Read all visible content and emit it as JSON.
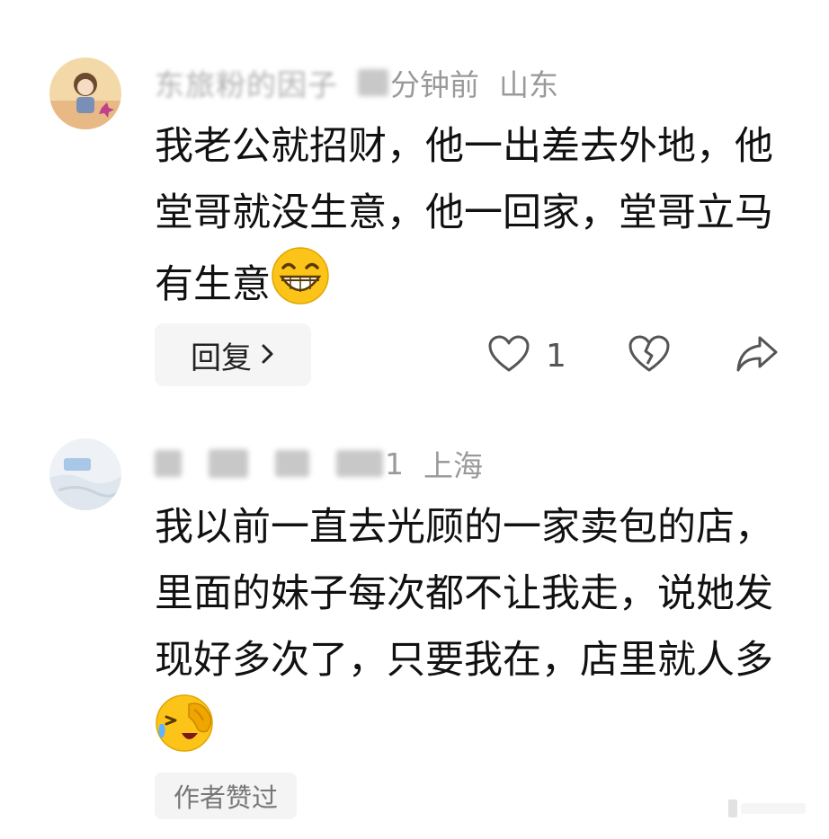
{
  "comments": [
    {
      "username": "东旅粉的因子",
      "time": "分钟前",
      "location": "山东",
      "text": "我老公就招财，他一出差去外地，他堂哥就没生意，他一回家，堂哥立马有生意",
      "reply_label": "回复",
      "like_count": "1"
    },
    {
      "time_suffix": "1",
      "location": "上海",
      "text": "我以前一直去光顾的一家卖包的店，里面的妹子每次都不让我走，说她发现好多次了，只要我在，店里就人多",
      "author_liked_label": "作者赞过"
    }
  ],
  "icons": {
    "reply_chevron": "chevron-right-icon",
    "like": "heart-outline-icon",
    "dislike": "broken-heart-icon",
    "share": "share-arrow-icon",
    "emoji_1": "grinning-face-emoji",
    "emoji_2": "laughing-tears-emoji"
  },
  "colors": {
    "text_primary": "#111111",
    "text_meta": "#9a9a9a",
    "button_bg": "#f5f5f5",
    "icon_gray": "#555555"
  }
}
